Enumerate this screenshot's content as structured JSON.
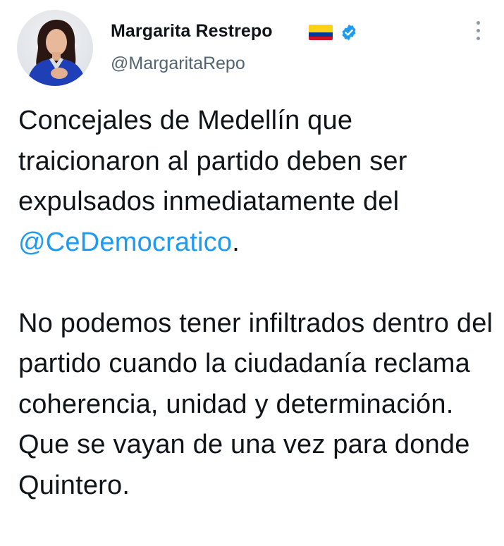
{
  "author": {
    "display_name": "Margarita Restrepo",
    "handle": "@MargaritaRepo",
    "flag_icon": "colombia-flag-icon",
    "verified_icon": "verified-badge-icon",
    "verified_color": "#1d9bf0"
  },
  "tweet": {
    "paragraph1": {
      "text_before": "Concejales de Medellín que traicionaron al partido deben ser expulsados inmediatamente del ",
      "mention": "@CeDemocratico",
      "text_after": "."
    },
    "paragraph2": "No podemos tener infiltrados dentro del partido cuando la ciudadanía reclama coherencia, unidad y determinación. Que se vayan de una vez para donde Quintero."
  },
  "colors": {
    "text": "#0f1419",
    "secondary": "#536471",
    "link": "#1d9bf0"
  }
}
